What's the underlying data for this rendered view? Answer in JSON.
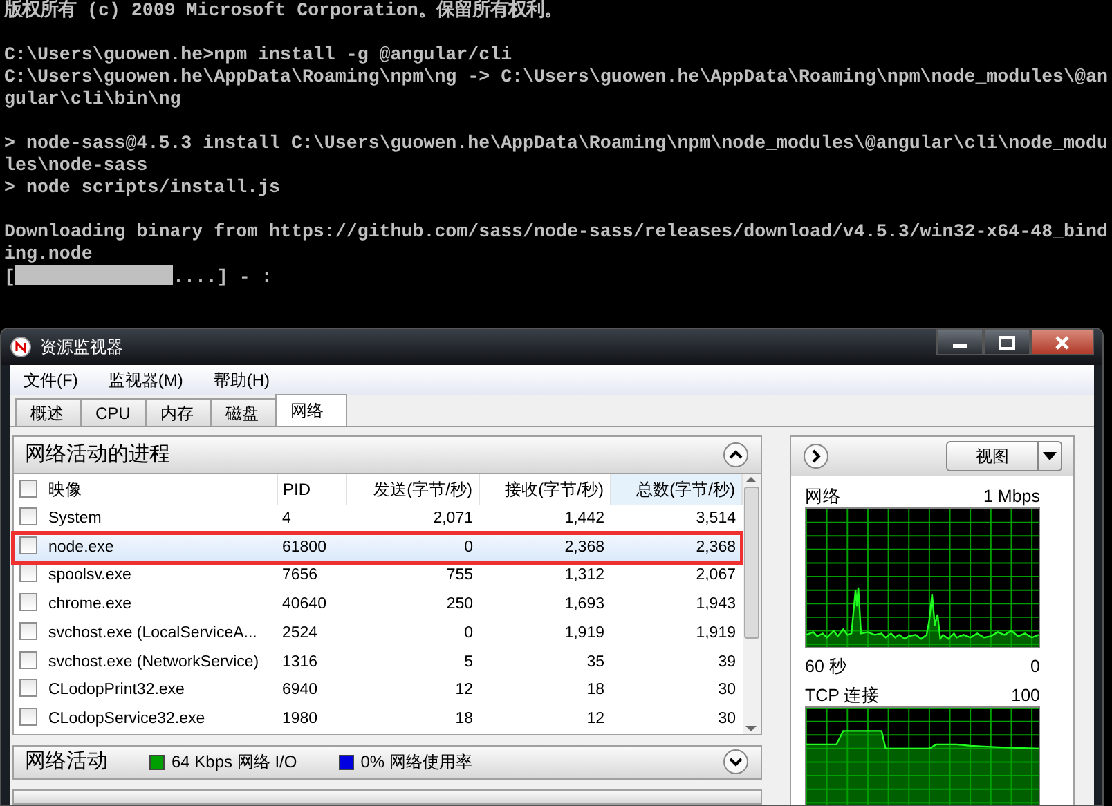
{
  "console": {
    "blocks": [
      [
        {
          "kind": "text",
          "text": "版权所有 (c) 2009 Microsoft Corporation。保留所有权利。"
        }
      ],
      [
        {
          "kind": "text",
          "text": "C:\\Users\\guowen.he>npm install -g @angular/cli"
        },
        {
          "kind": "text",
          "text": "C:\\Users\\guowen.he\\AppData\\Roaming\\npm\\ng -> C:\\Users\\guowen.he\\AppData\\Roaming\\npm\\node_modules\\@an"
        },
        {
          "kind": "text",
          "text": "gular\\cli\\bin\\ng"
        }
      ],
      [
        {
          "kind": "text",
          "text": "> node-sass@4.5.3 install C:\\Users\\guowen.he\\AppData\\Roaming\\npm\\node_modules\\@angular\\cli\\node_modu"
        },
        {
          "kind": "text",
          "text": "les\\node-sass"
        },
        {
          "kind": "text",
          "text": "> node scripts/install.js"
        }
      ],
      [
        {
          "kind": "text",
          "text": "Downloading binary from https://github.com/sass/node-sass/releases/download/v4.5.3/win32-x64-48_bind"
        },
        {
          "kind": "text",
          "text": "ing.node"
        },
        {
          "kind": "progress",
          "prefix": "[",
          "suffix": "....] - :"
        }
      ]
    ]
  },
  "window": {
    "title": "资源监视器",
    "menu": [
      "文件(F)",
      "监视器(M)",
      "帮助(H)"
    ],
    "tabs": [
      {
        "label": "概述",
        "selected": false
      },
      {
        "label": "CPU",
        "selected": false
      },
      {
        "label": "内存",
        "selected": false
      },
      {
        "label": "磁盘",
        "selected": false
      },
      {
        "label": "网络",
        "selected": true
      }
    ],
    "processes": {
      "title": "网络活动的进程",
      "expanded": true,
      "columns": [
        {
          "label": "映像",
          "sorted": false
        },
        {
          "label": "PID",
          "sorted": false
        },
        {
          "label": "发送(字节/秒)",
          "sorted": false
        },
        {
          "label": "接收(字节/秒)",
          "sorted": false
        },
        {
          "label": "总数(字节/秒)",
          "sorted": true
        }
      ],
      "rows": [
        {
          "checked": false,
          "selected": false,
          "highlighted": false,
          "cells": [
            "System",
            "4",
            "2,071",
            "1,442",
            "3,514"
          ]
        },
        {
          "checked": false,
          "selected": true,
          "highlighted": true,
          "cells": [
            "node.exe",
            "61800",
            "0",
            "2,368",
            "2,368"
          ]
        },
        {
          "checked": false,
          "selected": false,
          "highlighted": false,
          "cells": [
            "spoolsv.exe",
            "7656",
            "755",
            "1,312",
            "2,067"
          ]
        },
        {
          "checked": false,
          "selected": false,
          "highlighted": false,
          "cells": [
            "chrome.exe",
            "40640",
            "250",
            "1,693",
            "1,943"
          ]
        },
        {
          "checked": false,
          "selected": false,
          "highlighted": false,
          "cells": [
            "svchost.exe (LocalServiceA...",
            "2524",
            "0",
            "1,919",
            "1,919"
          ]
        },
        {
          "checked": false,
          "selected": false,
          "highlighted": false,
          "cells": [
            "svchost.exe (NetworkService)",
            "1316",
            "5",
            "35",
            "39"
          ]
        },
        {
          "checked": false,
          "selected": false,
          "highlighted": false,
          "cells": [
            "CLodopPrint32.exe",
            "6940",
            "12",
            "18",
            "30"
          ]
        },
        {
          "checked": false,
          "selected": false,
          "highlighted": false,
          "cells": [
            "CLodopService32.exe",
            "1980",
            "18",
            "12",
            "30"
          ]
        }
      ]
    },
    "activity": {
      "title": "网络活动",
      "expanded": false,
      "legend": [
        {
          "label": "64 Kbps 网络 I/O",
          "color": "#00a000"
        },
        {
          "label": "0% 网络使用率",
          "color": "#0000e0"
        }
      ]
    },
    "side": {
      "view_button": "视图",
      "graphs": [
        {
          "kind": "network",
          "title": "网络",
          "max": "1 Mbps",
          "span": "60 秒",
          "min": "0"
        },
        {
          "kind": "tcp",
          "title": "TCP 连接",
          "max": "100"
        }
      ]
    }
  }
}
